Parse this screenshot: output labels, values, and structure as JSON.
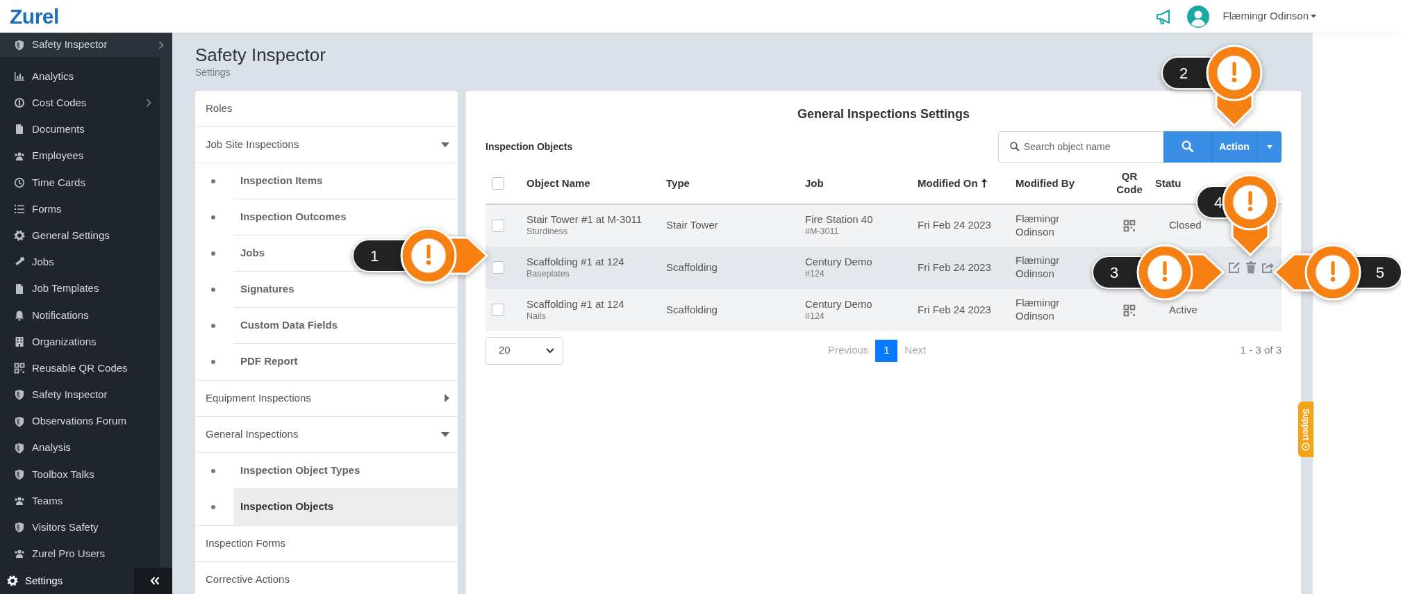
{
  "app": {
    "logo": "Zurel",
    "user_name": "Flæmingr Odinson"
  },
  "sidebar": {
    "top_item": {
      "label": "Safety Inspector",
      "has_submenu": true
    },
    "items": [
      {
        "label": "Analytics",
        "has_submenu": false
      },
      {
        "label": "Cost Codes",
        "has_submenu": true
      },
      {
        "label": "Documents",
        "has_submenu": false
      },
      {
        "label": "Employees",
        "has_submenu": false
      },
      {
        "label": "Time Cards",
        "has_submenu": false
      },
      {
        "label": "Forms",
        "has_submenu": false
      },
      {
        "label": "General Settings",
        "has_submenu": false
      },
      {
        "label": "Jobs",
        "has_submenu": false
      },
      {
        "label": "Job Templates",
        "has_submenu": false
      },
      {
        "label": "Notifications",
        "has_submenu": false
      },
      {
        "label": "Organizations",
        "has_submenu": false
      },
      {
        "label": "Reusable QR Codes",
        "has_submenu": false
      },
      {
        "label": "Safety Inspector",
        "has_submenu": false
      },
      {
        "label": "Observations Forum",
        "has_submenu": false
      },
      {
        "label": "Analysis",
        "has_submenu": false
      },
      {
        "label": "Toolbox Talks",
        "has_submenu": false
      },
      {
        "label": "Teams",
        "has_submenu": false
      },
      {
        "label": "Visitors Safety",
        "has_submenu": false
      },
      {
        "label": "Zurel Pro Users",
        "has_submenu": false
      }
    ],
    "footer": {
      "label": "Settings"
    }
  },
  "page": {
    "title": "Safety Inspector",
    "subtitle": "Settings"
  },
  "settings_menu": [
    {
      "label": "Roles"
    },
    {
      "label": "Job Site Inspections",
      "expanded": true,
      "children": [
        {
          "label": "Inspection Items",
          "selected": false
        },
        {
          "label": "Inspection Outcomes",
          "selected": false
        },
        {
          "label": "Jobs",
          "selected": false
        },
        {
          "label": "Signatures",
          "selected": false
        },
        {
          "label": "Custom Data Fields",
          "selected": false
        },
        {
          "label": "PDF Report",
          "selected": false
        }
      ]
    },
    {
      "label": "Equipment Inspections",
      "expanded": false
    },
    {
      "label": "General Inspections",
      "expanded": true,
      "children": [
        {
          "label": "Inspection Object Types",
          "selected": false
        },
        {
          "label": "Inspection Objects",
          "selected": true
        }
      ]
    },
    {
      "label": "Inspection Forms"
    },
    {
      "label": "Corrective Actions"
    }
  ],
  "card": {
    "title": "General Inspections Settings",
    "section_label": "Inspection Objects",
    "search": {
      "placeholder": "Search object name"
    },
    "action_button": "Action",
    "table": {
      "select_all_checked": false,
      "columns": [
        {
          "label": "Object Name",
          "sorted": false
        },
        {
          "label": "Type",
          "sorted": false
        },
        {
          "label": "Job",
          "sorted": false
        },
        {
          "label": "Modified On",
          "sorted": true
        },
        {
          "label": "Modified By",
          "sorted": false
        },
        {
          "label": "QR Code",
          "sorted": false
        },
        {
          "label": "Statu",
          "sorted": false
        }
      ],
      "rows": [
        {
          "checked": false,
          "hovered": false,
          "name": "Stair Tower #1 at M-3011",
          "item": "Sturdiness",
          "type": "Stair Tower",
          "job": "Fire Station 40",
          "job_number": "#M-3011",
          "modified_on": "Fri Feb 24 2023",
          "modified_by": "Flæmingr Odinson",
          "has_qr_code": true,
          "status": "Closed"
        },
        {
          "checked": false,
          "hovered": true,
          "name": "Scaffolding #1 at 124",
          "item": "Baseplates",
          "type": "Scaffolding",
          "job": "Century Demo",
          "job_number": "#124",
          "modified_on": "Fri Feb 24 2023",
          "modified_by": "Flæmingr Odinson",
          "has_qr_code": false
        },
        {
          "checked": false,
          "hovered": false,
          "name": "Scaffolding #1 at 124",
          "item": "Nails",
          "type": "Scaffolding",
          "job": "Century Demo",
          "job_number": "#124",
          "modified_on": "Fri Feb 24 2023",
          "modified_by": "Flæmingr Odinson",
          "has_qr_code": true,
          "status": "Active"
        }
      ]
    },
    "pagination": {
      "page_size": "20",
      "previous": "Previous",
      "previous_disabled": true,
      "pages": [
        {
          "label": "1",
          "selected": true
        }
      ],
      "next": "Next",
      "next_disabled": true,
      "summary": "1 - 3 of 3"
    }
  },
  "support": {
    "label": "Support"
  },
  "callouts": [
    {
      "number": "1",
      "kind": "right"
    },
    {
      "number": "2",
      "kind": "down"
    },
    {
      "number": "3",
      "kind": "right"
    },
    {
      "number": "4",
      "kind": "down"
    },
    {
      "number": "5",
      "kind": "left"
    }
  ]
}
